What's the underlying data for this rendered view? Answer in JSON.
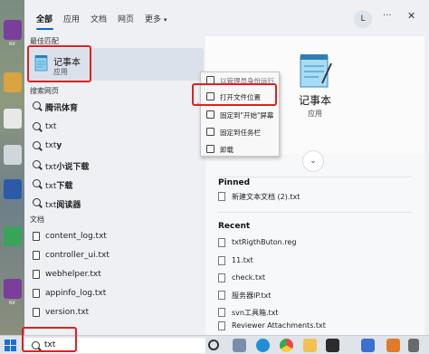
{
  "desktop": {
    "labels": [
      "新建",
      "PDF",
      "3",
      "手机",
      "网络",
      "sp",
      "WORD",
      "资料",
      "新建",
      "PDF"
    ]
  },
  "tabs": {
    "items": [
      "全部",
      "应用",
      "文档",
      "网页"
    ],
    "more_label": "更多",
    "avatar_letter": "L",
    "ellipsis": "···",
    "close": "✕"
  },
  "left": {
    "best_match_section": "最佳匹配",
    "best_match": {
      "title": "记事本",
      "subtitle": "应用"
    },
    "web_section": "搜索网页",
    "web_items": [
      {
        "label": "腾讯体育",
        "bold": true
      },
      {
        "label": "txt",
        "bold": false
      },
      {
        "label": "txty",
        "bold": false,
        "bold_suffix": "y",
        "prefix": "txt"
      },
      {
        "label": "txt小说下载",
        "prefix": "txt",
        "bold_suffix": "小说下载"
      },
      {
        "label": "txt下载",
        "prefix": "txt",
        "bold_suffix": "下载"
      },
      {
        "label": "txt阅读器",
        "prefix": "txt",
        "bold_suffix": "阅读器"
      }
    ],
    "docs_section": "文档",
    "doc_items": [
      "content_log.txt",
      "controller_ui.txt",
      "webhelper.txt",
      "appinfo_log.txt",
      "version.txt"
    ],
    "chevron": "›"
  },
  "context_menu": {
    "items": [
      "以管理员身份运行",
      "打开文件位置",
      "固定到\"开始\"屏幕",
      "固定到任务栏",
      "卸载"
    ]
  },
  "preview": {
    "title": "记事本",
    "subtitle": "应用",
    "expand": "⌄",
    "pinned_label": "Pinned",
    "pinned": [
      "新建文本文档 (2).txt"
    ],
    "recent_label": "Recent",
    "recent": [
      "txtRigthButon.reg",
      "11.txt",
      "check.txt",
      "服务器IP.txt",
      "svn工具箱.txt",
      "Reviewer Attachments.txt"
    ]
  },
  "taskbar": {
    "search_value": "txt"
  },
  "colors": {
    "accent": "#0a63c9",
    "highlight_box": "#e02020",
    "panel_bg": "#eef0f4"
  }
}
